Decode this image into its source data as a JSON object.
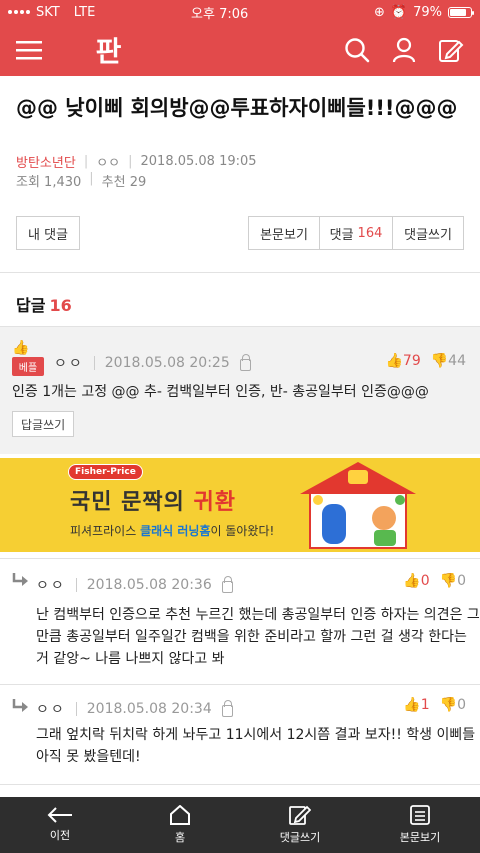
{
  "status": {
    "carrier": "SKT",
    "network": "LTE",
    "time": "오후 7:06",
    "battery": "79%",
    "battery_level": 0.79
  },
  "header": {
    "logo": "판",
    "icons": [
      "menu-icon",
      "search-icon",
      "user-icon",
      "write-icon"
    ]
  },
  "post": {
    "title": "@@ 낮이삐 회의방@@투표하자이삐들!!!@@@",
    "author": "방탄소년단",
    "nick": "ㅇㅇ",
    "date": "2018.05.08 19:05",
    "views": "조회 1,430",
    "recommend": "추천 29"
  },
  "buttons": {
    "my_comments": "내 댓글",
    "view_body": "본문보기",
    "comments_label": "댓글",
    "comments_count": "164",
    "write_comment": "댓글쓰기"
  },
  "replies": {
    "label": "답글",
    "count": "16"
  },
  "best": {
    "badge": "베플",
    "nick": "ㅇㅇ",
    "date": "2018.05.08 20:25",
    "up": "79",
    "down": "44",
    "text": "인증 1개는 고정 @@ 추- 컴백일부터 인증, 반- 총공일부터 인증@@@",
    "reply_button": "답글쓰기"
  },
  "ad": {
    "brand": "Fisher-Price",
    "headline_part1": "국민 문짝의",
    "headline_part2": "귀환",
    "sub_part1": "피셔프라이스",
    "sub_part2": "클래식 러닝홈",
    "sub_part3": "이 돌아왔다!"
  },
  "comments": [
    {
      "nick": "ㅇㅇ",
      "date": "2018.05.08 20:36",
      "up": "0",
      "down": "0",
      "lines": [
        "난 컴백부터 인증으로 추천 누르긴 했는데 총공일부터 인증 하자는 의견은 그",
        "만큼 총공일부터 일주일간 컴백을 위한 준비라고 할까 그런 걸 생각 한다는",
        "거 같앙~ 나름 나쁘지 않다고 봐"
      ]
    },
    {
      "nick": "ㅇㅇ",
      "date": "2018.05.08 20:34",
      "up": "1",
      "down": "0",
      "lines": [
        "그래 엎치락 뒤치락 하게 놔두고 11시에서 12시쯤 결과 보자!! 학생 이삐들",
        "아직 못 봤을텐데!"
      ]
    }
  ],
  "toolbar": {
    "prev": "이전",
    "home": "홈",
    "write": "댓글쓰기",
    "body": "본문보기"
  }
}
